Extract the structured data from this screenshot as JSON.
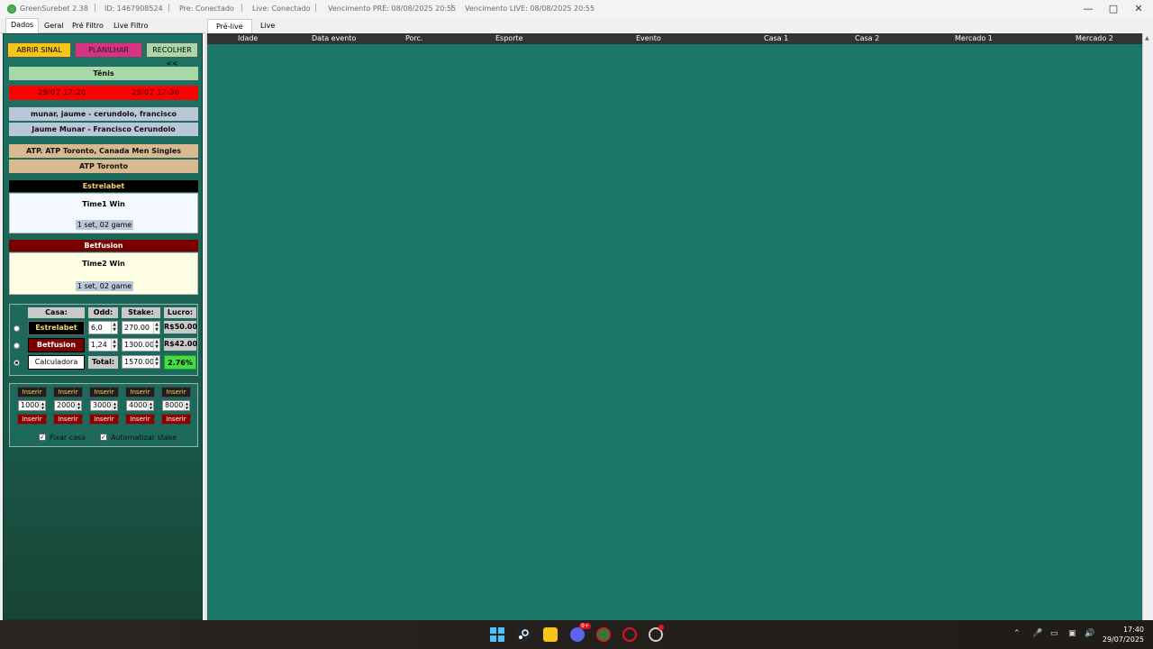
{
  "titlebar": {
    "app": "GreenSurebet 2.38",
    "id": "ID: 1467908524",
    "pre": "Pre: Conectado",
    "live": "Live: Conectado",
    "venc_pre": "Vencimento PRÉ: 08/08/2025 20:55",
    "venc_live": "Vencimento LIVE: 08/08/2025 20:55",
    "sep": "|"
  },
  "left_tabs": [
    "Dados",
    "Geral",
    "Pré Filtro",
    "Live Filtro"
  ],
  "right_tabs": [
    "Pré-live",
    "Live"
  ],
  "buttons": {
    "abrir": "ABRIR SINAL",
    "planilhar": "PLANILHAR",
    "recolher": "RECOLHER <<"
  },
  "signal": {
    "sport": "Tênis",
    "time_left": "29/07 17:20",
    "time_right": "29/07 17:30",
    "event1": "munar, jaume - cerundolo, francisco",
    "event2": "Jaume Munar - Francisco Cerundolo",
    "league1": "ATP. ATP Toronto, Canada Men Singles",
    "league2": "ATP Toronto",
    "house1": {
      "name": "Estrelabet",
      "market": "Time1 Win",
      "detail": "1 set, 02 game"
    },
    "house2": {
      "name": "Betfusion",
      "market": "Time2 Win",
      "detail": "1 set, 02 game"
    }
  },
  "calc": {
    "headers": {
      "casa": "Casa:",
      "odd": "Odd:",
      "stake": "Stake:",
      "lucro": "Lucro:"
    },
    "rows": [
      {
        "house": "Estrelabet",
        "odd": "6,0",
        "stake": "270.00",
        "lucro": "R$50.00"
      },
      {
        "house": "Betfusion",
        "odd": "1,24",
        "stake": "1300.00",
        "lucro": "R$42.00"
      }
    ],
    "calc_label": "Calculadora",
    "total_label": "Total:",
    "total": "1570.00",
    "percent": "2.76%"
  },
  "stakes": {
    "insert_label": "Inserir",
    "amounts": [
      "1000",
      "2000",
      "3000",
      "4000",
      "8000"
    ],
    "fixar": "Fixar casa",
    "automatizar": "Automatizar stake"
  },
  "table_headers": [
    "Idade",
    "Data evento",
    "Porc.",
    "Esporte",
    "Evento",
    "Casa 1",
    "Casa 2",
    "Mercado 1",
    "Mercado 2"
  ],
  "taskbar": {
    "time": "17:40",
    "date": "29/07/2025",
    "badge": "9+"
  },
  "colors": {
    "panel": "#1e7466",
    "main": "#1c7569",
    "estrelabet": "#000000",
    "betfusion": "#7a0000",
    "accent_yellow": "#f5c518",
    "accent_pink": "#d63384",
    "profit_green": "#44dd44"
  }
}
